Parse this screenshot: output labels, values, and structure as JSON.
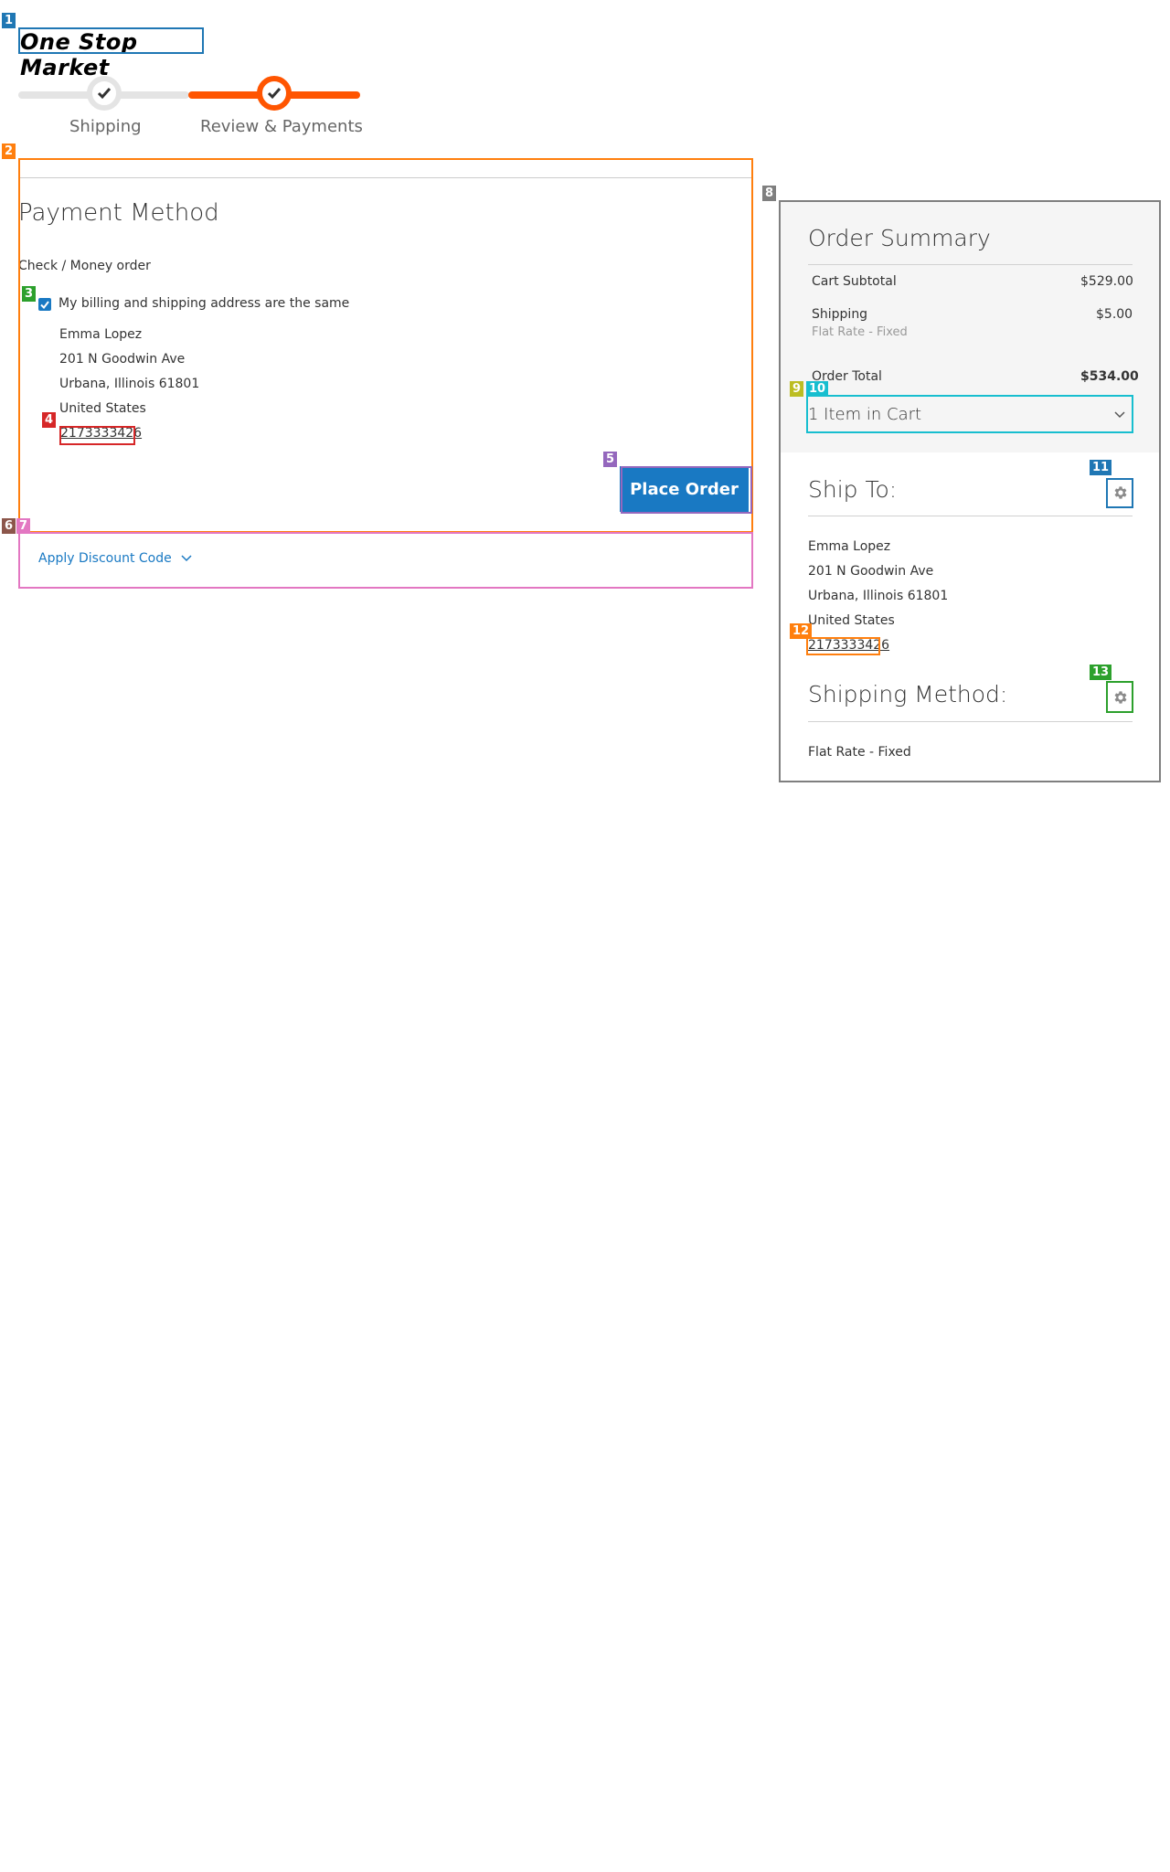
{
  "brand": {
    "logo_text": "One Stop Market"
  },
  "progress": {
    "steps": [
      {
        "label": "Shipping"
      },
      {
        "label": "Review & Payments"
      }
    ]
  },
  "payment": {
    "title": "Payment Method",
    "method_label": "Check / Money order",
    "same_address_label": "My billing and shipping address are the same",
    "same_address_checked": true,
    "billing": {
      "name": "Emma Lopez",
      "street": "201 N Goodwin Ave",
      "city_line": "Urbana, Illinois 61801",
      "country": "United States",
      "phone": "2173333426"
    },
    "place_order_label": "Place Order"
  },
  "discount": {
    "label": "Apply Discount Code"
  },
  "summary": {
    "title": "Order Summary",
    "cart_subtotal_label": "Cart Subtotal",
    "cart_subtotal_value": "$529.00",
    "shipping_label": "Shipping",
    "shipping_value": "$5.00",
    "shipping_method_note": "Flat Rate - Fixed",
    "order_total_label": "Order Total",
    "order_total_value": "$534.00",
    "items_in_cart_label": "1 Item in Cart"
  },
  "ship_to": {
    "title": "Ship To:",
    "name": "Emma Lopez",
    "street": "201 N Goodwin Ave",
    "city_line": "Urbana, Illinois 61801",
    "country": "United States",
    "phone": "2173333426"
  },
  "shipping_method": {
    "title": "Shipping Method:",
    "value": "Flat Rate - Fixed"
  },
  "markers": [
    "1",
    "2",
    "3",
    "4",
    "5",
    "6",
    "7",
    "8",
    "9",
    "10",
    "11",
    "12",
    "13"
  ],
  "colors": {
    "accent": "#ff5501",
    "link": "#1979c3",
    "step_inactive": "#e4e4e4"
  }
}
